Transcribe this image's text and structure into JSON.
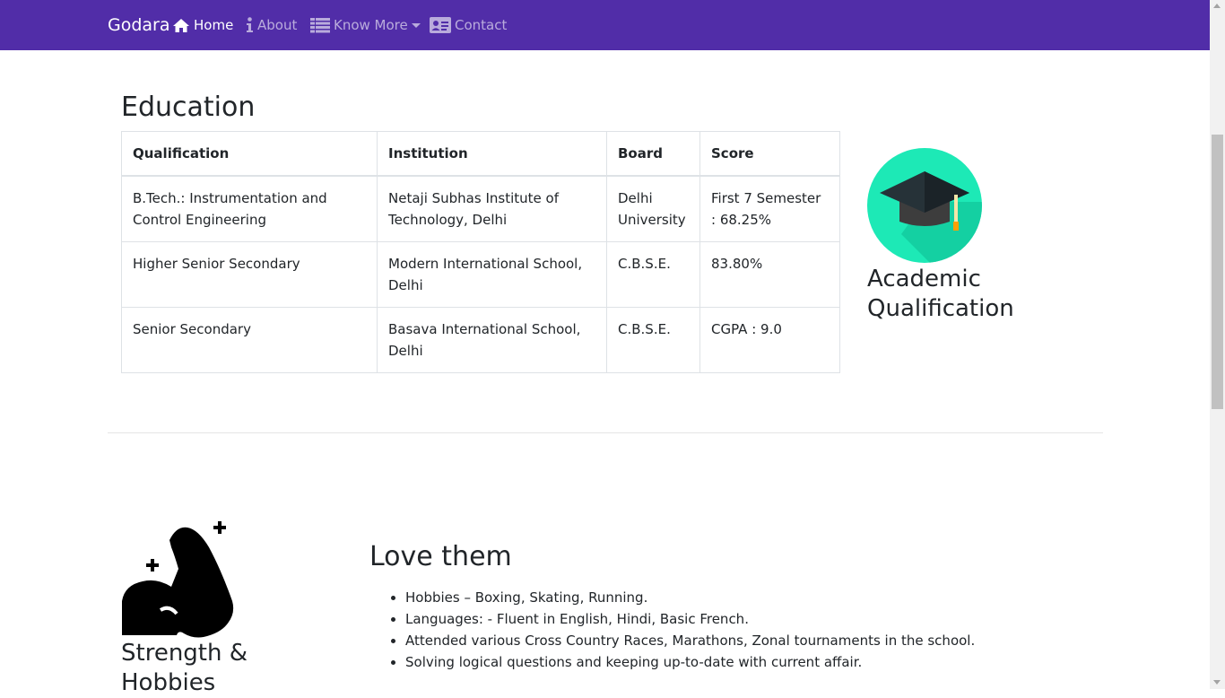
{
  "navbar": {
    "brand": "Godara",
    "items": [
      {
        "label": "Home",
        "icon": "home-icon",
        "active": true
      },
      {
        "label": "About",
        "icon": "info-icon",
        "active": false
      },
      {
        "label": "Know More",
        "icon": "list-icon",
        "active": false,
        "dropdown": true
      },
      {
        "label": "Contact",
        "icon": "address-card-icon",
        "active": false
      }
    ],
    "color": "#512da8"
  },
  "education": {
    "title": "Education",
    "table": {
      "headers": [
        "Qualification",
        "Institution",
        "Board",
        "Score"
      ],
      "rows": [
        [
          "B.Tech.: Instrumentation and Control Engineering",
          "Netaji Subhas Institute of Technology, Delhi",
          "Delhi University",
          "First 7 Semester : 68.25%"
        ],
        [
          "Higher Senior Secondary",
          "Modern International School, Delhi",
          "C.B.S.E.",
          "83.80%"
        ],
        [
          "Senior Secondary",
          "Basava International School, Delhi",
          "C.B.S.E.",
          "CGPA : 9.0"
        ]
      ]
    },
    "side_icon": "graduation-cap-icon",
    "side_title": "Academic Qualification"
  },
  "hobbies": {
    "side_icon": "flexed-bicep-icon",
    "side_title": "Strength & Hobbies",
    "title": "Love them",
    "items": [
      "Hobbies – Boxing, Skating, Running.",
      "Languages: - Fluent in English, Hindi, Basic French.",
      "Attended various Cross Country Races, Marathons, Zonal tournaments in the school.",
      "Solving logical questions and keeping up-to-date with current affair."
    ]
  }
}
